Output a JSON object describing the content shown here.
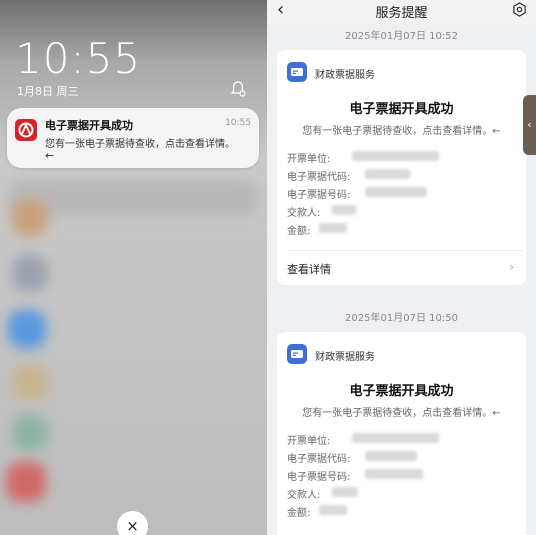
{
  "lockscreen": {
    "time": "10:55",
    "date": "1月8日 周三",
    "notification": {
      "title": "电子票据开具成功",
      "time": "10:55",
      "body": "您有一张电子票据待查收，点击查看详情。",
      "arrow": "←"
    },
    "close_label": "×"
  },
  "service": {
    "nav_title": "服务提醒",
    "back_label": "‹",
    "cards": [
      {
        "timestamp": "2025年01月07日 10:52",
        "service_name": "财政票据服务",
        "title": "电子票据开具成功",
        "desc": "您有一张电子票据待查收，点击查看详情。←",
        "fields": [
          "开票单位:",
          "电子票据代码:",
          "电子票据号码:",
          "交款人:",
          "金额:"
        ],
        "detail_link": "查看详情"
      },
      {
        "timestamp": "2025年01月07日 10:50",
        "service_name": "财政票据服务",
        "title": "电子票据开具成功",
        "desc": "您有一张电子票据待查收，点击查看详情。←",
        "fields": [
          "开票单位:",
          "电子票据代码:",
          "电子票据号码:",
          "交款人:",
          "金额:"
        ]
      }
    ],
    "side_tab": "‹"
  },
  "colors": {
    "accent_blue": "#3e6fd8",
    "app_red": "#d8222a"
  }
}
